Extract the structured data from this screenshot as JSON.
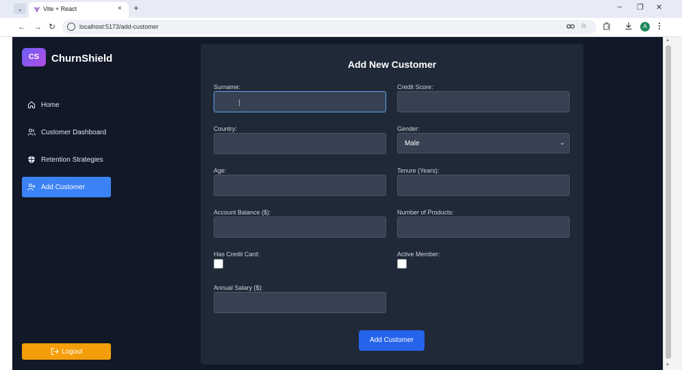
{
  "browser": {
    "tab_title": "Vite + React",
    "tab_close": "×",
    "new_tab": "+",
    "url": "localhost:5173/add-customer",
    "profile_initial": "A",
    "tab_list_glyph": "⌄",
    "back_glyph": "←",
    "forward_glyph": "→",
    "reload_glyph": "↻",
    "minimize_glyph": "–",
    "restore_glyph": "❐",
    "close_glyph": "✕"
  },
  "sidebar": {
    "logo_initials": "CS",
    "brand": "ChurnShield",
    "items": [
      {
        "label": "Home",
        "icon": "home-icon",
        "active": false
      },
      {
        "label": "Customer Dashboard",
        "icon": "users-icon",
        "active": false
      },
      {
        "label": "Retention Strategies",
        "icon": "shield-icon",
        "active": false
      },
      {
        "label": "Add Customer",
        "icon": "user-plus-icon",
        "active": true
      }
    ],
    "logout_label": "Logout"
  },
  "form": {
    "title": "Add New Customer",
    "fields": {
      "surname": {
        "label": "Surname:",
        "value": ""
      },
      "credit_score": {
        "label": "Credit Score:",
        "value": ""
      },
      "country": {
        "label": "Country:",
        "value": ""
      },
      "gender": {
        "label": "Gender:",
        "value": "Male"
      },
      "age": {
        "label": "Age:",
        "value": ""
      },
      "tenure": {
        "label": "Tenure (Years):",
        "value": ""
      },
      "balance": {
        "label": "Account Balance ($):",
        "value": ""
      },
      "products": {
        "label": "Number of Products:",
        "value": ""
      },
      "has_cr_card": {
        "label": "Has Credit Card:",
        "checked": false
      },
      "active_member": {
        "label": "Active Member:",
        "checked": false
      },
      "salary": {
        "label": "Annual Salary ($):",
        "value": ""
      }
    },
    "submit_label": "Add Customer"
  },
  "colors": {
    "background": "#111827",
    "card": "#1f2937",
    "input": "#374151",
    "accent": "#3b82f6",
    "submit": "#2563eb",
    "logout": "#f59e0b"
  }
}
